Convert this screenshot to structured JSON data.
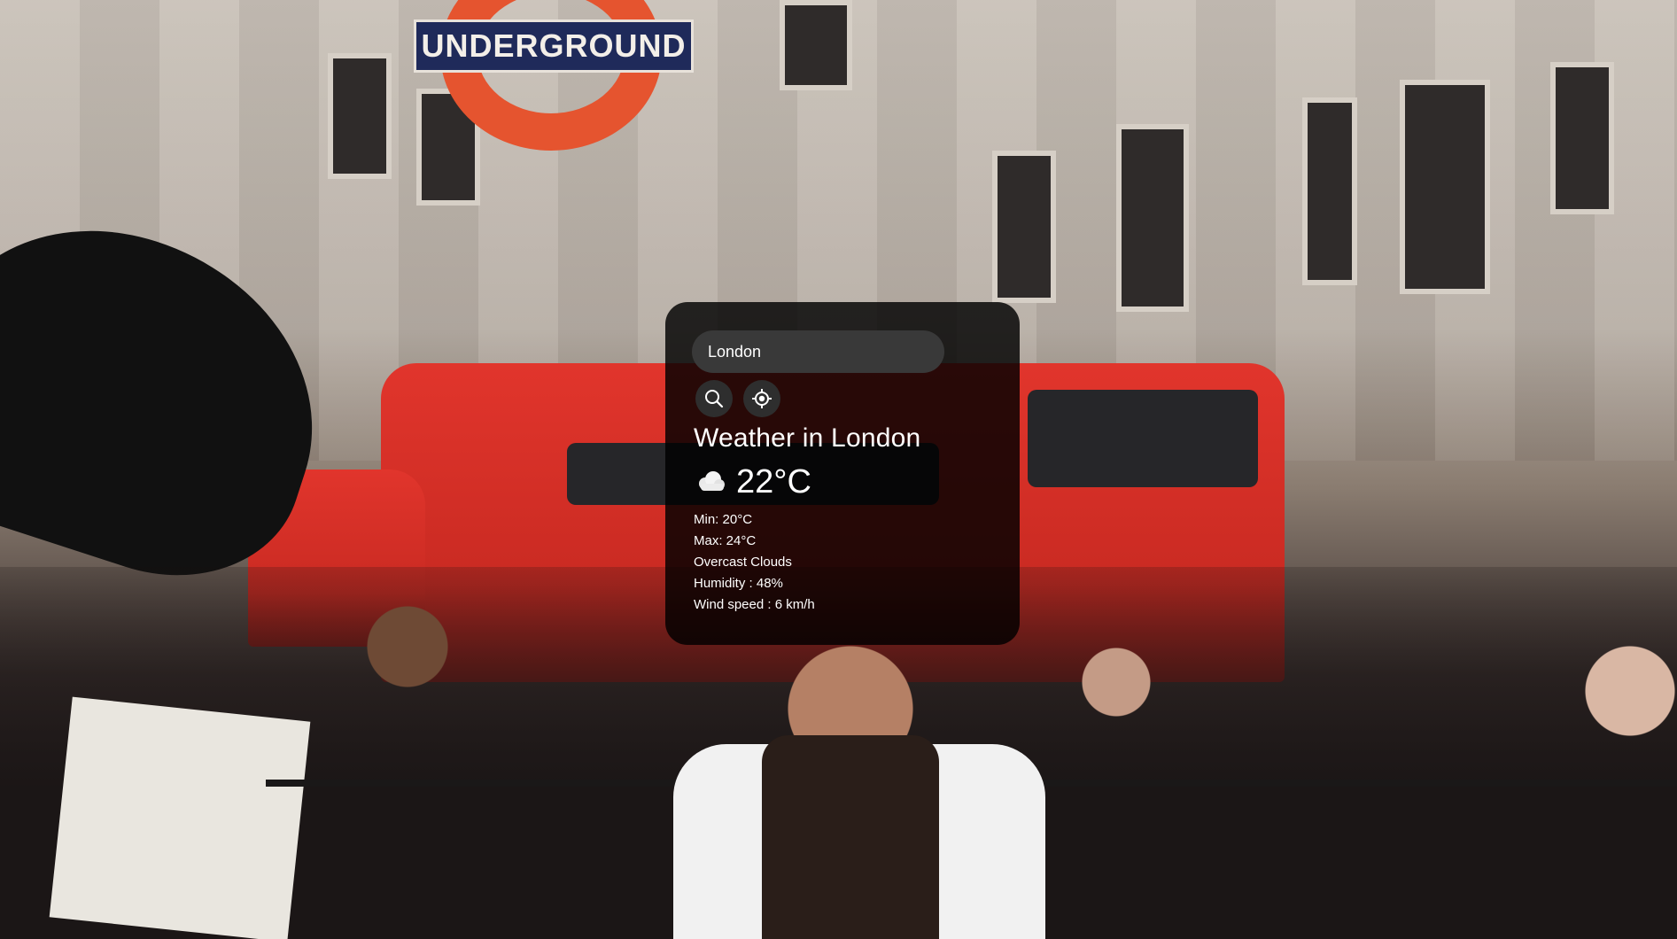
{
  "search": {
    "value": "London",
    "search_icon": "search-icon",
    "location_icon": "crosshair-location-icon"
  },
  "weather": {
    "title": "Weather in London",
    "condition_icon": "cloud-icon",
    "temperature": "22°C",
    "min": "Min: 20°C",
    "max": "Max: 24°C",
    "description": "Overcast Clouds",
    "humidity": "Humidity : 48%",
    "wind": "Wind speed : 6 km/h"
  },
  "background": {
    "sign_text": "UNDERGROUND"
  },
  "colors": {
    "card_bg": "#000000",
    "input_bg": "#393939",
    "text": "#ffffff"
  }
}
